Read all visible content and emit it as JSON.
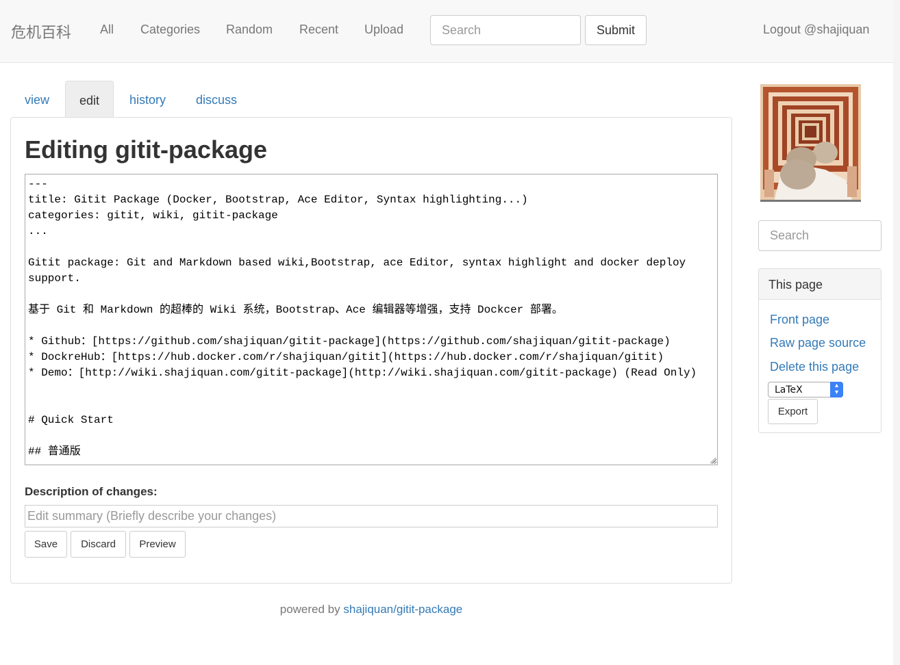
{
  "navbar": {
    "brand": "危机百科",
    "links": [
      "All",
      "Categories",
      "Random",
      "Recent",
      "Upload"
    ],
    "search_placeholder": "Search",
    "submit_label": "Submit",
    "logout_label": "Logout @shajiquan"
  },
  "tabs": [
    {
      "label": "view",
      "active": false
    },
    {
      "label": "edit",
      "active": true
    },
    {
      "label": "history",
      "active": false
    },
    {
      "label": "discuss",
      "active": false
    }
  ],
  "main": {
    "title": "Editing gitit-package",
    "editor_content": "---\ntitle: Gitit Package (Docker, Bootstrap, Ace Editor, Syntax highlighting...)\ncategories: gitit, wiki, gitit-package\n...\n\nGitit package: Git and Markdown based wiki,Bootstrap, ace Editor, syntax highlight and docker deploy support.\n\n基于 Git 和 Markdown 的超棒的 Wiki 系统，Bootstrap、Ace 编辑器等增强，支持 Dockcer 部署。\n\n* Github：[https://github.com/shajiquan/gitit-package](https://github.com/shajiquan/gitit-package)\n* DockreHub：[https://hub.docker.com/r/shajiquan/gitit](https://hub.docker.com/r/shajiquan/gitit)\n* Demo：[http://wiki.shajiquan.com/gitit-package](http://wiki.shajiquan.com/gitit-package) (Read Only)\n\n\n# Quick Start\n\n## 普通版",
    "description_label": "Description of changes:",
    "description_placeholder": "Edit summary (Briefly describe your changes)",
    "buttons": {
      "save": "Save",
      "discard": "Discard",
      "preview": "Preview"
    }
  },
  "footer": {
    "prefix": "powered by",
    "link": "shajiquan/gitit-package"
  },
  "sidebar": {
    "search_placeholder": "Search",
    "panel_title": "This page",
    "links": [
      "Front page",
      "Raw page source",
      "Delete this page"
    ],
    "format_selected": "LaTeX",
    "export_label": "Export"
  },
  "colors": {
    "link": "#337ab7",
    "navbar_bg": "#f8f8f8",
    "select_accent": "#3b82f6"
  }
}
